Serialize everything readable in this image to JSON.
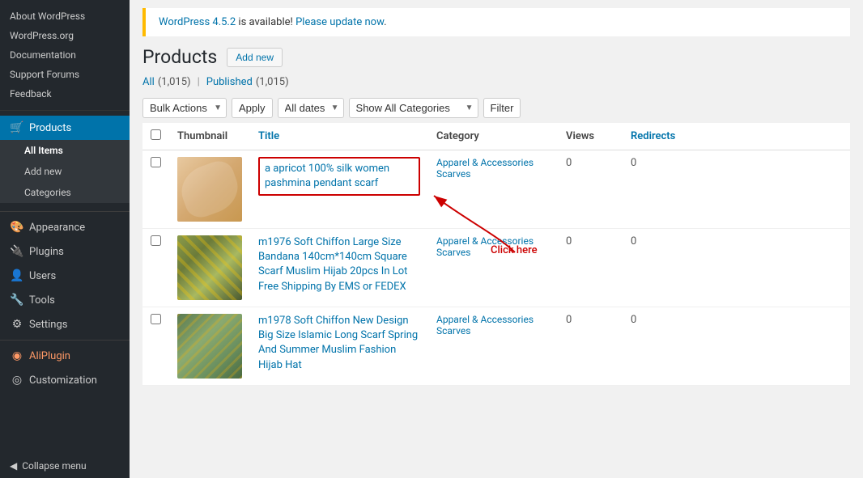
{
  "sidebar": {
    "top_links": [
      {
        "label": "About WordPress",
        "name": "about-wordpress"
      },
      {
        "label": "WordPress.org",
        "name": "wordpress-org"
      },
      {
        "label": "Documentation",
        "name": "documentation"
      },
      {
        "label": "Support Forums",
        "name": "support-forums"
      },
      {
        "label": "Feedback",
        "name": "feedback"
      }
    ],
    "menu_items": [
      {
        "label": "Products",
        "icon": "🛒",
        "name": "products",
        "active": true
      },
      {
        "label": "Appearance",
        "icon": "🎨",
        "name": "appearance"
      },
      {
        "label": "Plugins",
        "icon": "🔌",
        "name": "plugins"
      },
      {
        "label": "Users",
        "icon": "👤",
        "name": "users"
      },
      {
        "label": "Tools",
        "icon": "🔧",
        "name": "tools"
      },
      {
        "label": "Settings",
        "icon": "⚙",
        "name": "settings"
      }
    ],
    "sub_items": [
      {
        "label": "All Items",
        "name": "all-items",
        "active": true
      },
      {
        "label": "Add new",
        "name": "add-new-sub"
      },
      {
        "label": "Categories",
        "name": "categories-sub"
      }
    ],
    "bottom_links": [
      {
        "label": "AliPlugin",
        "icon": "◉",
        "name": "aliplugin"
      },
      {
        "label": "Customization",
        "icon": "◎",
        "name": "customization"
      }
    ],
    "collapse_label": "Collapse menu"
  },
  "update_notice": {
    "text_before": "WordPress 4.5.2",
    "text_middle": " is available! ",
    "link_text": "Please update now",
    "link_suffix": "."
  },
  "page": {
    "title": "Products",
    "add_new_label": "Add new"
  },
  "filter_links": {
    "all_label": "All",
    "all_count": "(1,015)",
    "published_label": "Published",
    "published_count": "(1,015)"
  },
  "toolbar": {
    "bulk_actions_label": "Bulk Actions",
    "apply_label": "Apply",
    "all_dates_label": "All dates",
    "show_all_categories_label": "Show All Categories",
    "filter_label": "Filter"
  },
  "table": {
    "columns": [
      "",
      "Thumbnail",
      "Title",
      "Category",
      "Views",
      "Redirects"
    ],
    "rows": [
      {
        "title": "a apricot 100% silk women pashmina pendant scarf",
        "category_line1": "Apparel & Accessories",
        "category_line2": "Scarves",
        "views": "0",
        "redirects": "0",
        "highlighted": true,
        "thumb_class": "scarf1"
      },
      {
        "title": "m1976 Soft Chiffon Large Size Bandana 140cm*140cm Square Scarf Muslim Hijab 20pcs In Lot Free Shipping By EMS or FEDEX",
        "category_line1": "Apparel & Accessories",
        "category_line2": "Scarves",
        "views": "0",
        "redirects": "0",
        "highlighted": false,
        "thumb_class": "scarf2"
      },
      {
        "title": "m1978 Soft Chiffon New Design Big Size Islamic Long Scarf Spring And Summer Muslim Fashion Hijab Hat",
        "category_line1": "Apparel & Accessories",
        "category_line2": "Scarves",
        "views": "0",
        "redirects": "0",
        "highlighted": false,
        "thumb_class": "scarf3"
      }
    ]
  },
  "annotation": {
    "click_here_label": "Click here"
  }
}
